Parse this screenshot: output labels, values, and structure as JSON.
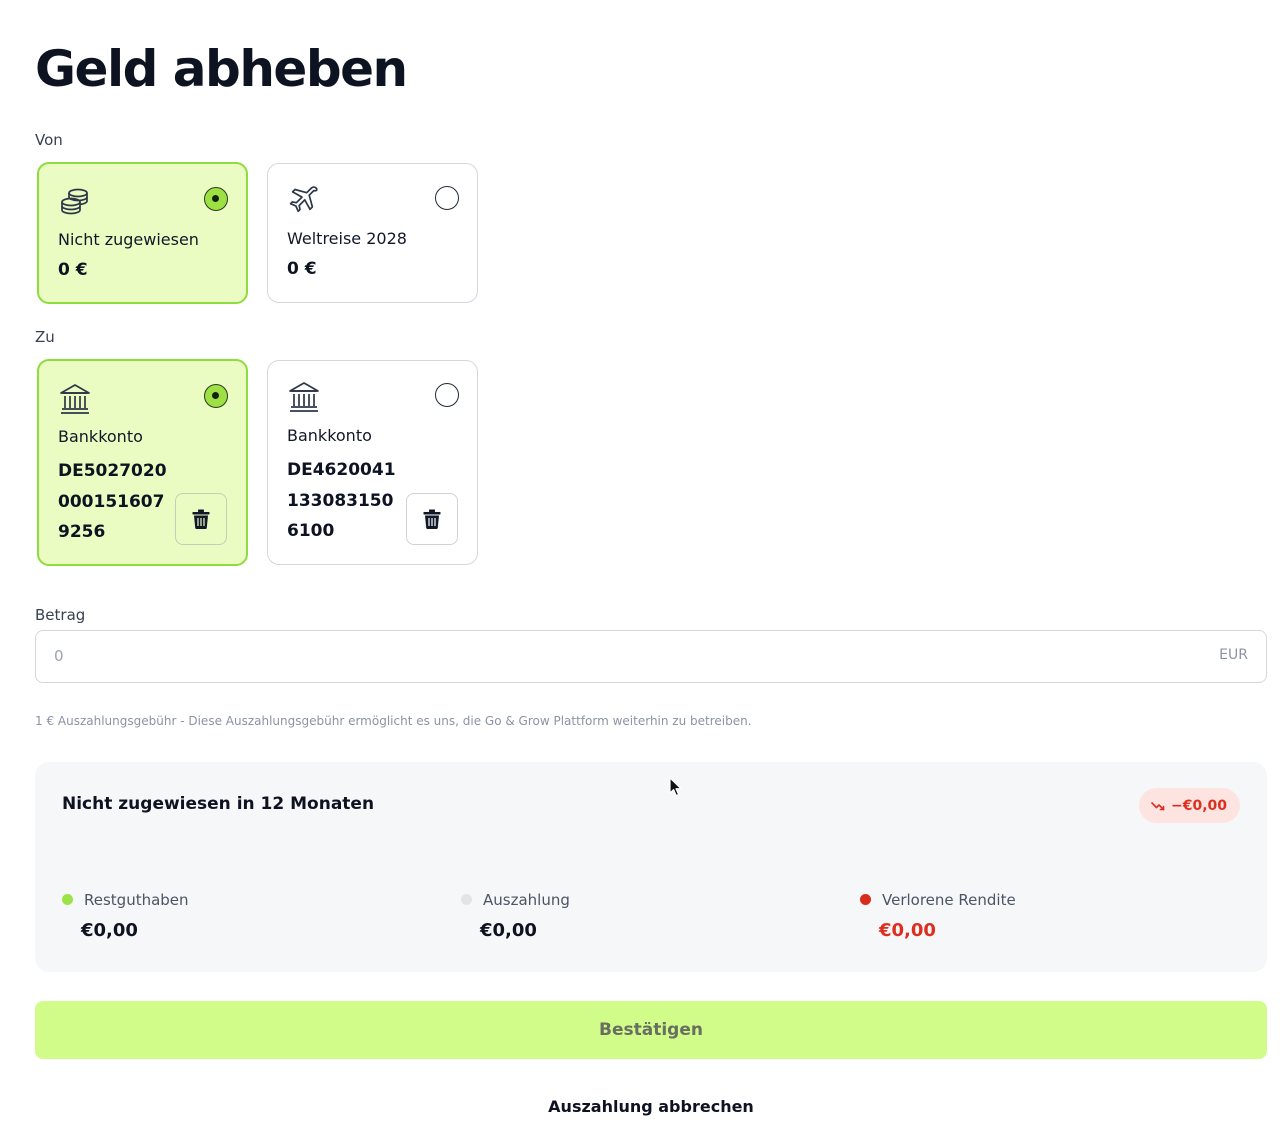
{
  "page": {
    "title": "Geld abheben"
  },
  "from": {
    "label": "Von",
    "options": [
      {
        "icon": "coins-stack-icon",
        "name": "Nicht zugewiesen",
        "amount": "0 €",
        "selected": true
      },
      {
        "icon": "airplane-icon",
        "name": "Weltreise 2028",
        "amount": "0 €",
        "selected": false
      }
    ]
  },
  "to": {
    "label": "Zu",
    "options": [
      {
        "icon": "bank-icon",
        "name": "Bankkonto",
        "iban": "DE50270200001516079256",
        "selected": true
      },
      {
        "icon": "bank-icon",
        "name": "Bankkonto",
        "iban": "DE46200411330831506100",
        "selected": false
      }
    ]
  },
  "amount": {
    "label": "Betrag",
    "placeholder": "0",
    "value": "",
    "currency": "EUR"
  },
  "fee_note": "1 € Auszahlungsgebühr - Diese Auszahlungsgebühr ermöglicht es uns, die Go & Grow Plattform weiterhin zu betreiben.",
  "forecast": {
    "title": "Nicht zugewiesen in 12 Monaten",
    "delta": "−€0,00",
    "metrics": [
      {
        "label": "Restguthaben",
        "value": "€0,00",
        "dot_color": "#9be34a"
      },
      {
        "label": "Auszahlung",
        "value": "€0,00",
        "dot_color": "#e2e4e8"
      },
      {
        "label": "Verlorene Rendite",
        "value": "€0,00",
        "dot_color": "#d82e1c"
      }
    ]
  },
  "actions": {
    "confirm": "Bestätigen",
    "cancel": "Auszahlung abbrechen"
  },
  "colors": {
    "selected_bg": "#ebfcc3",
    "selected_border": "#8edc3e",
    "accent": "#d2fc8a",
    "negative": "#dc2f1f"
  }
}
